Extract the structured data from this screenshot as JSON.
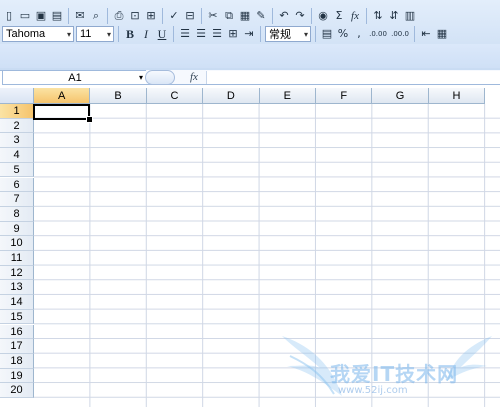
{
  "toolbar": {
    "font_name": "Tahoma",
    "font_size": "11",
    "number_format": "常规",
    "bold_label": "B",
    "italic_label": "I",
    "underline_label": "U",
    "percent_label": "%",
    "comma_label": ",",
    "increase_decimal_label": ".0.00",
    "decrease_decimal_label": ".00.0",
    "sum_label": "Σ",
    "fx_label": "fx"
  },
  "name_box": {
    "value": "A1"
  },
  "formula_bar": {
    "fx_label": "fx",
    "value": ""
  },
  "grid": {
    "columns": [
      "A",
      "B",
      "C",
      "D",
      "E",
      "F",
      "G",
      "H"
    ],
    "rows": [
      "1",
      "2",
      "3",
      "4",
      "5",
      "6",
      "7",
      "8",
      "9",
      "10",
      "11",
      "12",
      "13",
      "14",
      "15",
      "16",
      "17",
      "18",
      "19",
      "20"
    ],
    "active_column": "A",
    "active_row": "1"
  },
  "watermark": {
    "text": "我爱IT技术网",
    "url": "www.52ij.com"
  }
}
